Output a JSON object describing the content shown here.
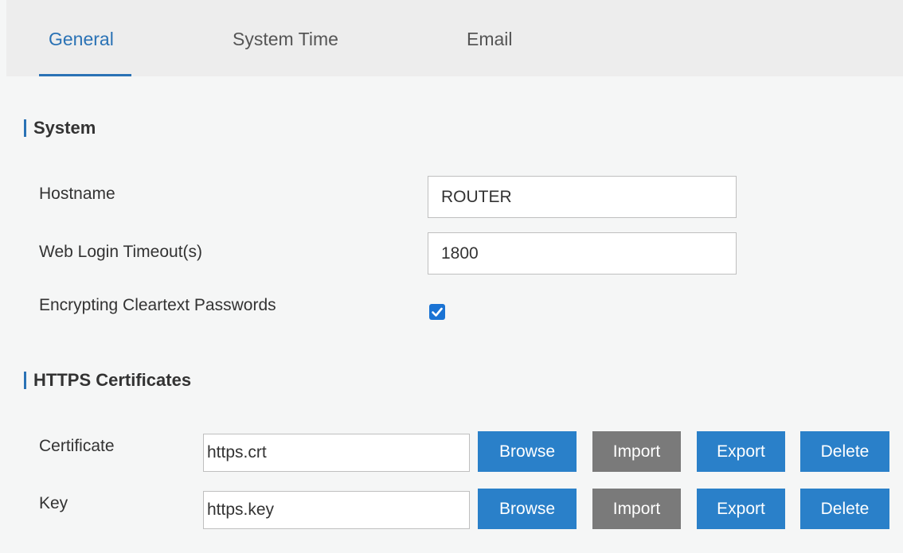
{
  "tabs": [
    {
      "label": "General",
      "active": true
    },
    {
      "label": "System Time",
      "active": false
    },
    {
      "label": "Email",
      "active": false
    }
  ],
  "system": {
    "title": "System",
    "hostname_label": "Hostname",
    "hostname_value": "ROUTER",
    "timeout_label": "Web Login Timeout(s)",
    "timeout_value": "1800",
    "encrypt_label": "Encrypting Cleartext Passwords",
    "encrypt_checked": true
  },
  "https": {
    "title": "HTTPS Certificates",
    "rows": [
      {
        "label": "Certificate",
        "value": "https.crt",
        "browse": "Browse",
        "import": "Import",
        "export": "Export",
        "delete": "Delete"
      },
      {
        "label": "Key",
        "value": "https.key",
        "browse": "Browse",
        "import": "Import",
        "export": "Export",
        "delete": "Delete"
      }
    ]
  },
  "colors": {
    "accent": "#2a72b5",
    "button_blue": "#2a80c9",
    "button_gray": "#7a7a7a",
    "checkbox": "#1a73d4"
  }
}
